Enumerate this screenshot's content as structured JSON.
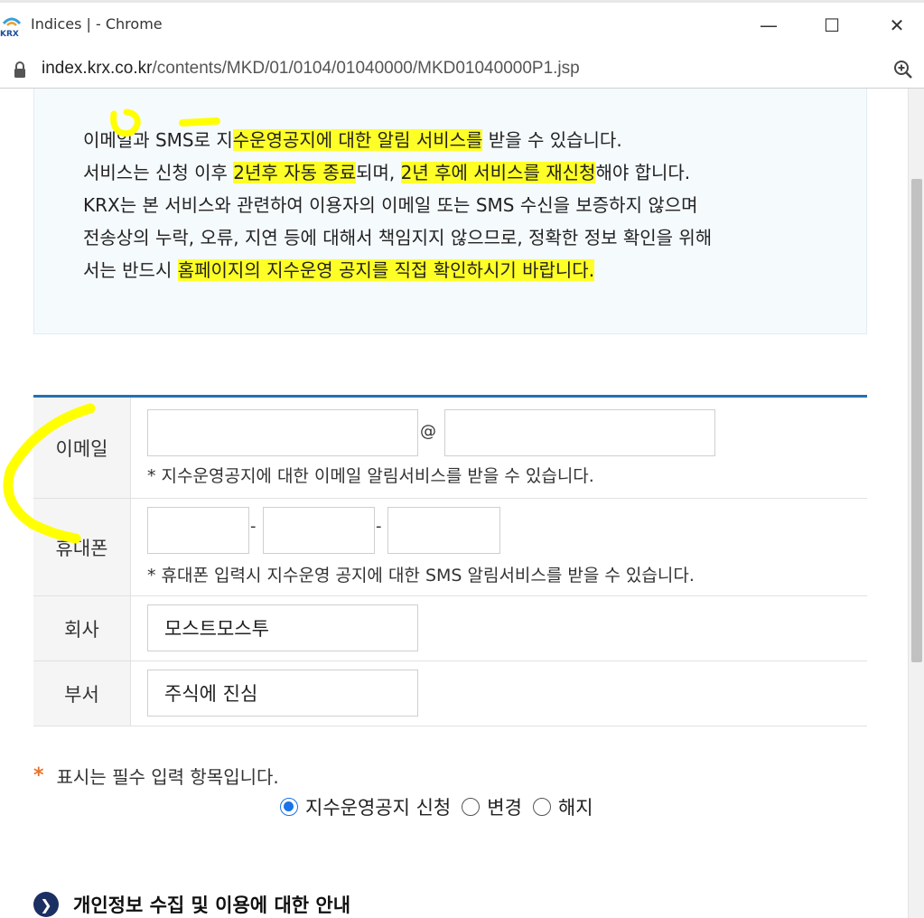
{
  "window": {
    "title": "Indices | - Chrome",
    "minimize": "—",
    "maximize": "☐",
    "close": "✕"
  },
  "address": {
    "host": "index.krx.co.kr",
    "path": "/contents/MKD/01/0104/01040000/MKD01040000P1.jsp"
  },
  "notice": {
    "lines": [
      [
        "이메일과 SMS로 지",
        "수운영공지에 대한 알림 서비스를",
        " 받을 수 있습니다."
      ],
      [
        "서비스는 신청 이후 ",
        "2년후 자동 종료",
        "되며, ",
        "2년 후에 서비스를 재신청",
        "해야 합니다."
      ],
      [
        "KRX는 본 서비스와 관련하여 이용자의 이메일 또는 SMS 수신을 보증하지 않으며"
      ],
      [
        "전송상의 누락, 오류, 지연 등에 대해서 책임지지 않으므로, 정확한 정보 확인을 위해"
      ],
      [
        "서는 반드시 ",
        "홈페이지의 지수운영 공지를 직접 확인하시기 바랍니다."
      ]
    ]
  },
  "form": {
    "email": {
      "label": "이메일",
      "at": "@",
      "user_value": "",
      "domain_value": "",
      "hint": "* 지수운영공지에 대한 이메일 알림서비스를 받을 수 있습니다."
    },
    "phone": {
      "label": "휴대폰",
      "dash": "-",
      "part1": "",
      "part2": "",
      "part3": "",
      "hint": "* 휴대폰 입력시 지수운영 공지에 대한 SMS 알림서비스를 받을 수 있습니다."
    },
    "company": {
      "label": "회사",
      "value": "모스트모스투"
    },
    "department": {
      "label": "부서",
      "value": "주식에 진심"
    }
  },
  "required_note": {
    "star": "*",
    "text": "표시는 필수 입력 항목입니다."
  },
  "options": [
    {
      "label": "지수운영공지 신청",
      "checked": true
    },
    {
      "label": "변경",
      "checked": false
    },
    {
      "label": "해지",
      "checked": false
    }
  ],
  "privacy": {
    "arrow": "❯",
    "title": "개인정보 수집 및 이용에 대한 안내"
  },
  "colors": {
    "accent": "#2470b3",
    "highlight": "#ffff00",
    "radio": "#1a73e8",
    "star": "#e8742a"
  }
}
